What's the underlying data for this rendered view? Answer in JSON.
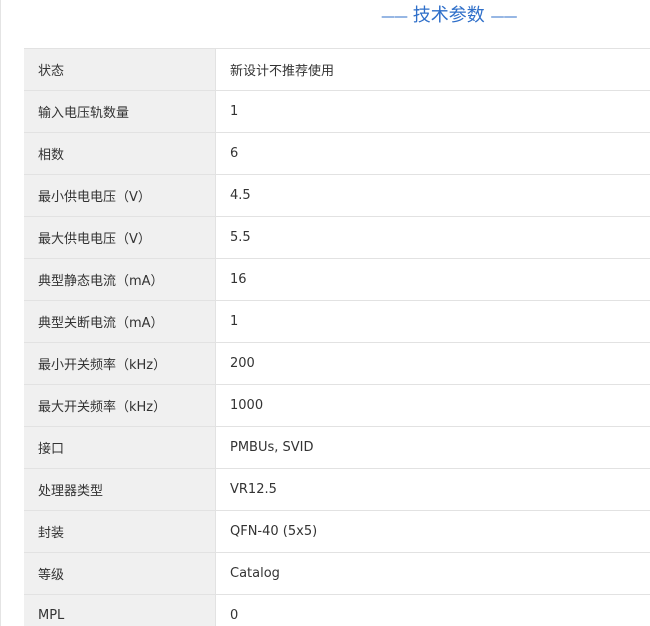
{
  "section": {
    "dash_left": "——",
    "title": "技术参数",
    "dash_right": "——"
  },
  "params": [
    {
      "label": "状态",
      "value": "新设计不推荐使用"
    },
    {
      "label": "输入电压轨数量",
      "value": "1"
    },
    {
      "label": "相数",
      "value": "6"
    },
    {
      "label": "最小供电电压（V）",
      "value": "4.5"
    },
    {
      "label": "最大供电电压（V）",
      "value": "5.5"
    },
    {
      "label": "典型静态电流（mA）",
      "value": "16"
    },
    {
      "label": "典型关断电流（mA）",
      "value": "1"
    },
    {
      "label": "最小开关频率（kHz）",
      "value": "200"
    },
    {
      "label": "最大开关频率（kHz）",
      "value": "1000"
    },
    {
      "label": "接口",
      "value": "PMBUs, SVID"
    },
    {
      "label": "处理器类型",
      "value": "VR12.5"
    },
    {
      "label": "封装",
      "value": "QFN-40 (5x5)"
    },
    {
      "label": "等级",
      "value": "Catalog"
    },
    {
      "label": "MPL",
      "value": "0"
    }
  ]
}
